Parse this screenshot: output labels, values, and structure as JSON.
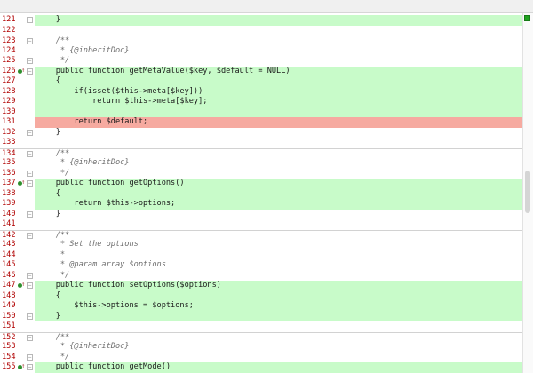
{
  "lines": [
    {
      "n": "121",
      "text": "    }",
      "bg": "added",
      "fold": "end"
    },
    {
      "n": "122",
      "text": "",
      "bg": "none"
    },
    {
      "n": "123",
      "text": "    /**",
      "bg": "none",
      "fold": "start",
      "divider": true,
      "kind": "comment"
    },
    {
      "n": "124",
      "text": "     * {@inheritDoc}",
      "bg": "none",
      "kind": "comment"
    },
    {
      "n": "125",
      "text": "     */",
      "bg": "none",
      "fold": "end",
      "kind": "comment"
    },
    {
      "n": "126",
      "text": "    public function getMetaValue($key, $default = NULL)",
      "bg": "added",
      "marker": true,
      "fold": "start"
    },
    {
      "n": "127",
      "text": "    {",
      "bg": "added"
    },
    {
      "n": "128",
      "text": "        if(isset($this->meta[$key]))",
      "bg": "added"
    },
    {
      "n": "129",
      "text": "            return $this->meta[$key];",
      "bg": "added"
    },
    {
      "n": "130",
      "text": "",
      "bg": "added"
    },
    {
      "n": "131",
      "text": "        return $default;",
      "bg": "removed"
    },
    {
      "n": "132",
      "text": "    }",
      "bg": "none",
      "fold": "end"
    },
    {
      "n": "133",
      "text": "",
      "bg": "none"
    },
    {
      "n": "134",
      "text": "    /**",
      "bg": "none",
      "fold": "start",
      "divider": true,
      "kind": "comment"
    },
    {
      "n": "135",
      "text": "     * {@inheritDoc}",
      "bg": "none",
      "kind": "comment"
    },
    {
      "n": "136",
      "text": "     */",
      "bg": "none",
      "fold": "end",
      "kind": "comment"
    },
    {
      "n": "137",
      "text": "    public function getOptions()",
      "bg": "added",
      "marker": true,
      "fold": "start"
    },
    {
      "n": "138",
      "text": "    {",
      "bg": "added"
    },
    {
      "n": "139",
      "text": "        return $this->options;",
      "bg": "added"
    },
    {
      "n": "140",
      "text": "    }",
      "bg": "none",
      "fold": "end"
    },
    {
      "n": "141",
      "text": "",
      "bg": "none"
    },
    {
      "n": "142",
      "text": "    /**",
      "bg": "none",
      "fold": "start",
      "divider": true,
      "kind": "comment"
    },
    {
      "n": "143",
      "text": "     * Set the options",
      "bg": "none",
      "kind": "comment"
    },
    {
      "n": "144",
      "text": "     *",
      "bg": "none",
      "kind": "comment"
    },
    {
      "n": "145",
      "text": "     * @param array $options",
      "bg": "none",
      "kind": "comment"
    },
    {
      "n": "146",
      "text": "     */",
      "bg": "none",
      "fold": "end",
      "kind": "comment"
    },
    {
      "n": "147",
      "text": "    public function setOptions($options)",
      "bg": "added",
      "marker": true,
      "fold": "start"
    },
    {
      "n": "148",
      "text": "    {",
      "bg": "added"
    },
    {
      "n": "149",
      "text": "        $this->options = $options;",
      "bg": "added"
    },
    {
      "n": "150",
      "text": "    }",
      "bg": "added",
      "fold": "end"
    },
    {
      "n": "151",
      "text": "",
      "bg": "none"
    },
    {
      "n": "152",
      "text": "    /**",
      "bg": "none",
      "fold": "start",
      "divider": true,
      "kind": "comment"
    },
    {
      "n": "153",
      "text": "     * {@inheritDoc}",
      "bg": "none",
      "kind": "comment"
    },
    {
      "n": "154",
      "text": "     */",
      "bg": "none",
      "fold": "end",
      "kind": "comment"
    },
    {
      "n": "155",
      "text": "    public function getMode()",
      "bg": "added",
      "marker": true,
      "fold": "start"
    }
  ],
  "colors": {
    "added": "#c8fbc9",
    "removed": "#f6aaa0",
    "line_number": "#b00000",
    "status_ok": "#1ea21e"
  }
}
